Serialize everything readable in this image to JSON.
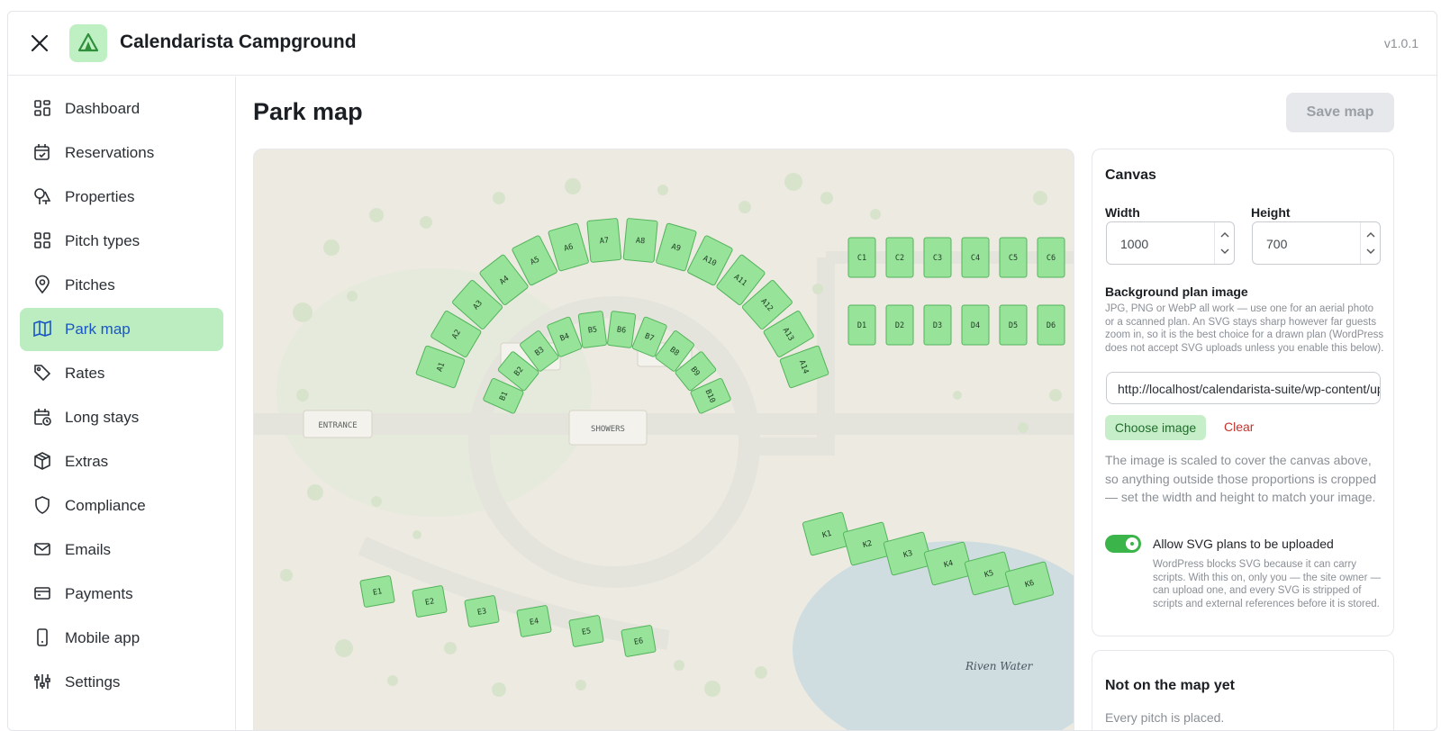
{
  "app": {
    "title": "Calendarista Campground",
    "version": "v1.0.1"
  },
  "sidebar": {
    "items": [
      {
        "label": "Dashboard",
        "icon": "dashboard-icon"
      },
      {
        "label": "Reservations",
        "icon": "calendar-check-icon"
      },
      {
        "label": "Properties",
        "icon": "trees-icon"
      },
      {
        "label": "Pitch types",
        "icon": "grid-icon"
      },
      {
        "label": "Pitches",
        "icon": "map-pin-icon"
      },
      {
        "label": "Park map",
        "icon": "map-icon",
        "active": true
      },
      {
        "label": "Rates",
        "icon": "tag-icon"
      },
      {
        "label": "Long stays",
        "icon": "calendar-clock-icon"
      },
      {
        "label": "Extras",
        "icon": "package-icon"
      },
      {
        "label": "Compliance",
        "icon": "shield-icon"
      },
      {
        "label": "Emails",
        "icon": "mail-icon"
      },
      {
        "label": "Payments",
        "icon": "credit-card-icon"
      },
      {
        "label": "Mobile app",
        "icon": "smartphone-icon"
      },
      {
        "label": "Settings",
        "icon": "sliders-icon"
      }
    ]
  },
  "main": {
    "title": "Park map",
    "save_label": "Save map"
  },
  "map": {
    "entrance_label": "ENTRANCE",
    "showers_label": "SHOWERS",
    "water_label": "Riven Water",
    "pitches": {
      "outer_arc": [
        "A1",
        "A2",
        "A3",
        "A4",
        "A5",
        "A6",
        "A7",
        "A8",
        "A9",
        "A10",
        "A11",
        "A12",
        "A13",
        "A14"
      ],
      "inner_arc": [
        "B1",
        "B2",
        "B3",
        "B4",
        "B5",
        "B6",
        "B7",
        "B8",
        "B9",
        "B10"
      ],
      "c_row": [
        "C1",
        "C2",
        "C3",
        "C4",
        "C5",
        "C6"
      ],
      "d_row": [
        "D1",
        "D2",
        "D3",
        "D4",
        "D5",
        "D6"
      ],
      "e_row": [
        "E1",
        "E2",
        "E3",
        "E4",
        "E5",
        "E6"
      ],
      "k_row": [
        "K1",
        "K2",
        "K3",
        "K4",
        "K5",
        "K6"
      ]
    }
  },
  "canvas": {
    "heading": "Canvas",
    "width_label": "Width",
    "width_value": "1000",
    "height_label": "Height",
    "height_value": "700",
    "bg_label": "Background plan image",
    "bg_help": "JPG, PNG or WebP all work — use one for an aerial photo or a scanned plan. An SVG stays sharp however far guests zoom in, so it is the best choice for a drawn plan (WordPress does not accept SVG uploads unless you enable this below).",
    "bg_url": "http://localhost/calendarista-suite/wp-content/uploads/park-plan.svg",
    "choose_label": "Choose image",
    "clear_label": "Clear",
    "scaled_note": "The image is scaled to cover the canvas above, so anything outside those proportions is cropped — set the width and height to match your image.",
    "svg_toggle_label": "Allow SVG plans to be uploaded",
    "svg_toggle_on": true,
    "svg_toggle_help": "WordPress blocks SVG because it can carry scripts. With this on, only you — the site owner — can upload one, and every SVG is stripped of scripts and external references before it is stored."
  },
  "unplaced": {
    "heading": "Not on the map yet",
    "note": "Every pitch is placed."
  },
  "colors": {
    "accent": "#3bb44a",
    "active_nav_bg": "#bcedc0",
    "pitch_fill": "#97e39a",
    "pitch_stroke": "#52b35a",
    "clear_red": "#c4322c"
  }
}
